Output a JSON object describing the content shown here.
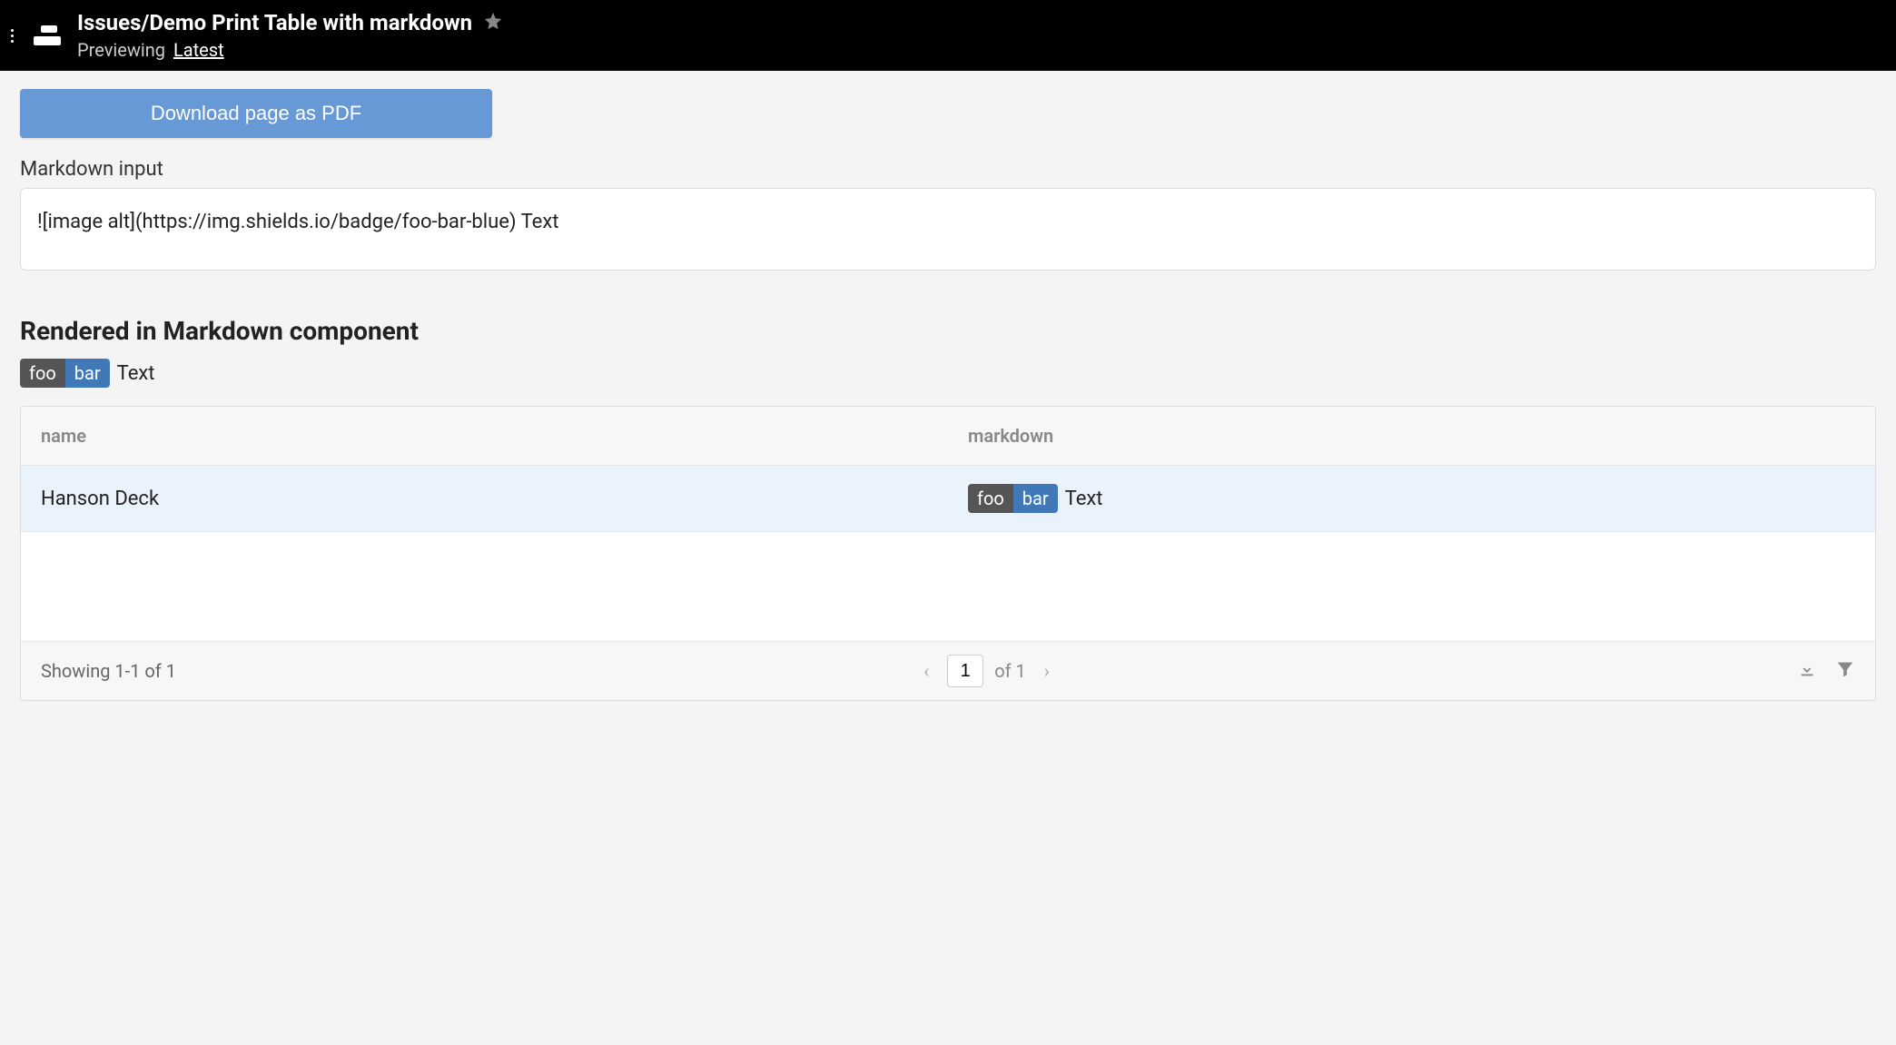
{
  "header": {
    "title": "Issues/Demo Print Table with markdown",
    "subtitle_prefix": "Previewing",
    "subtitle_link": "Latest"
  },
  "download_button": "Download page as PDF",
  "markdown_input": {
    "label": "Markdown input",
    "value": "![image alt](https://img.shields.io/badge/foo-bar-blue) Text"
  },
  "rendered": {
    "heading": "Rendered in Markdown component",
    "badge_left": "foo",
    "badge_right": "bar",
    "trailing_text": "Text"
  },
  "table": {
    "columns": [
      "name",
      "markdown"
    ],
    "rows": [
      {
        "name": "Hanson Deck",
        "badge_left": "foo",
        "badge_right": "bar",
        "trailing_text": "Text"
      }
    ],
    "footer": {
      "showing": "Showing 1-1 of 1",
      "page": "1",
      "of": "of 1"
    }
  }
}
